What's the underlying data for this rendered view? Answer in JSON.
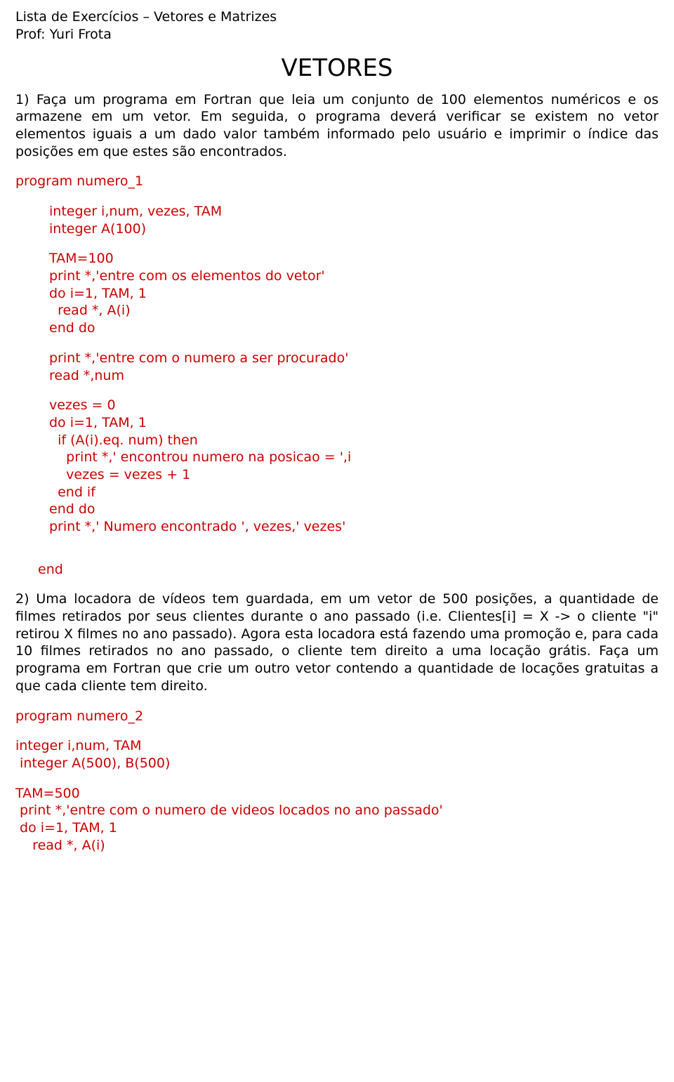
{
  "header": {
    "line1": "Lista de Exercícios – Vetores e Matrizes",
    "line2": "Prof: Yuri Frota"
  },
  "title": "VETORES",
  "q1": {
    "p1": "1) Faça um programa em Fortran que leia um conjunto de 100 elementos numéricos e os armazene em um vetor. Em seguida, o programa deverá verificar se existem no vetor elementos iguais a um dado valor também informado pelo usuário e imprimir o índice das posições em que estes são encontrados.",
    "c1": "program numero_1",
    "c2": "integer i,num, vezes, TAM",
    "c3": "integer A(100)",
    "c4": "TAM=100",
    "c5": "print *,'entre com os elementos do vetor'",
    "c6": "do i=1, TAM, 1",
    "c7": "  read *, A(i)",
    "c8": "end do",
    "c9": "print *,'entre com o numero a ser procurado'",
    "c10": "read *,num",
    "c11": "vezes = 0",
    "c12": "do i=1, TAM, 1",
    "c13": "  if (A(i).eq. num) then",
    "c14": "    print *,' encontrou numero na posicao = ',i",
    "c15": "    vezes = vezes + 1",
    "c16": "  end if",
    "c17": "end do",
    "c18": "print *,' Numero encontrado ', vezes,' vezes'",
    "c19": "end"
  },
  "q2": {
    "p1": "2) Uma locadora de vídeos tem guardada, em um vetor de 500 posições, a quantidade de filmes retirados por seus clientes durante o ano passado (i.e. Clientes[i] = X -> o cliente \"i\" retirou X filmes no ano passado). Agora esta locadora está fazendo uma promoção e, para cada 10 filmes retirados  no ano passado, o cliente tem direito a uma locação grátis. Faça um programa em Fortran que crie um outro vetor contendo a quantidade de locações gratuitas a que cada cliente tem direito.",
    "c1": "program numero_2",
    "c2": "integer i,num, TAM",
    "c3": " integer A(500), B(500)",
    "c4": "TAM=500",
    "c5": " print *,'entre com o numero de videos locados no ano passado'",
    "c6": " do i=1, TAM, 1",
    "c7": "    read *, A(i)"
  }
}
